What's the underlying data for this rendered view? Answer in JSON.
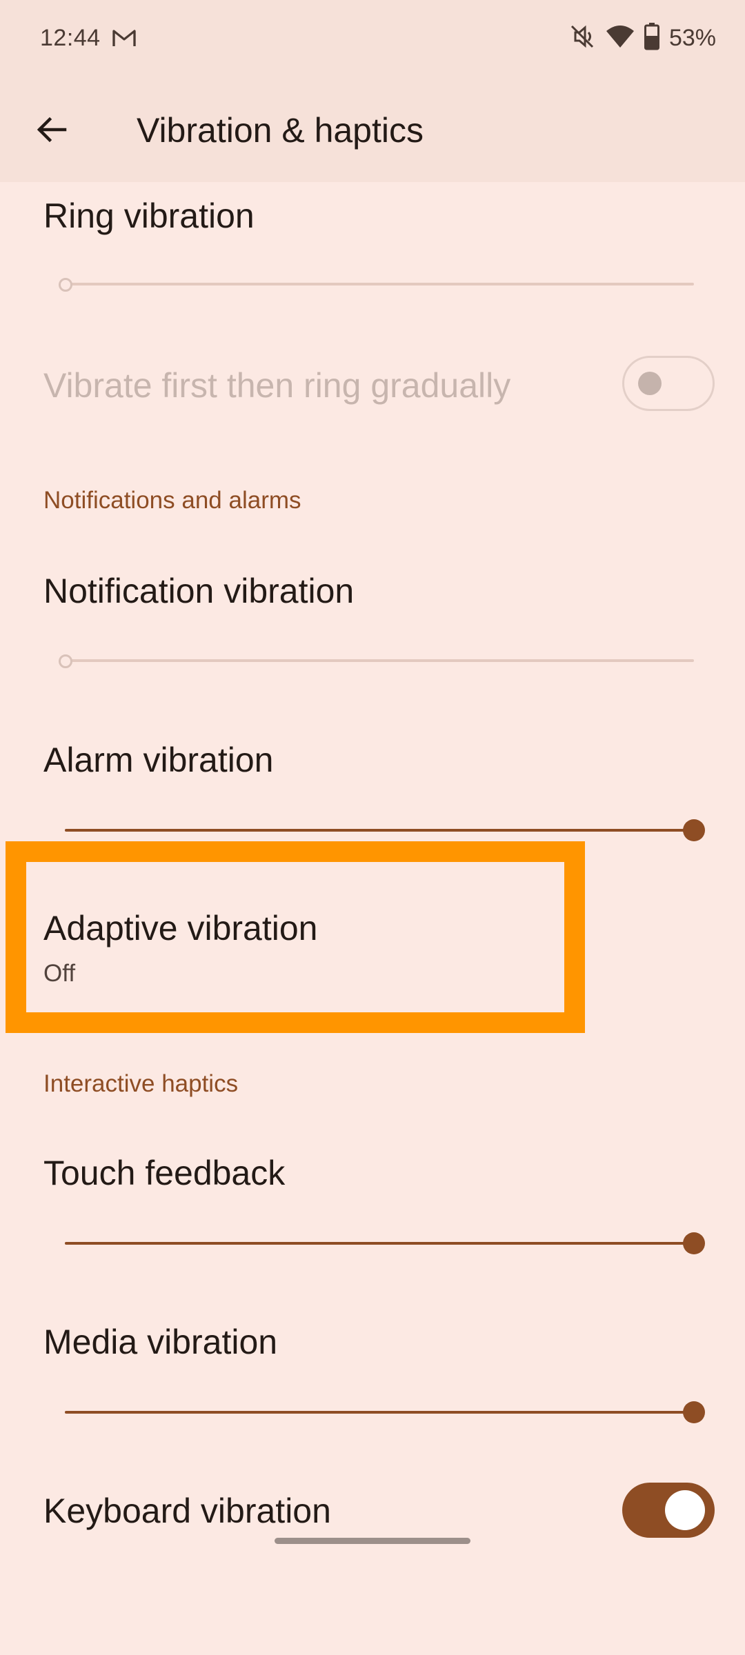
{
  "status_bar": {
    "time": "12:44",
    "battery_percent": "53%",
    "icons": [
      "gmail-icon",
      "mute-vibrate-icon",
      "wifi-icon",
      "battery-icon"
    ]
  },
  "app_bar": {
    "title": "Vibration & haptics",
    "back_icon": "arrow-back-icon"
  },
  "ring_vibration": {
    "title": "Ring vibration",
    "slider_value": 0
  },
  "vibrate_first": {
    "title": "Vibrate first then ring gradually",
    "enabled": false,
    "checked": false
  },
  "notifications_section": {
    "header": "Notifications and alarms"
  },
  "notification_vibration": {
    "title": "Notification vibration",
    "slider_value": 0
  },
  "alarm_vibration": {
    "title": "Alarm vibration",
    "slider_value": 1
  },
  "adaptive_vibration": {
    "title": "Adaptive vibration",
    "summary": "Off"
  },
  "interactive_section": {
    "header": "Interactive haptics"
  },
  "touch_feedback": {
    "title": "Touch feedback",
    "slider_value": 1
  },
  "media_vibration": {
    "title": "Media vibration",
    "slider_value": 1
  },
  "keyboard_vibration": {
    "title": "Keyboard vibration",
    "checked": true
  },
  "colors": {
    "background": "#fce9e3",
    "app_bar": "#f6e1d9",
    "accent": "#8e4d24",
    "highlight": "#ff9500"
  }
}
